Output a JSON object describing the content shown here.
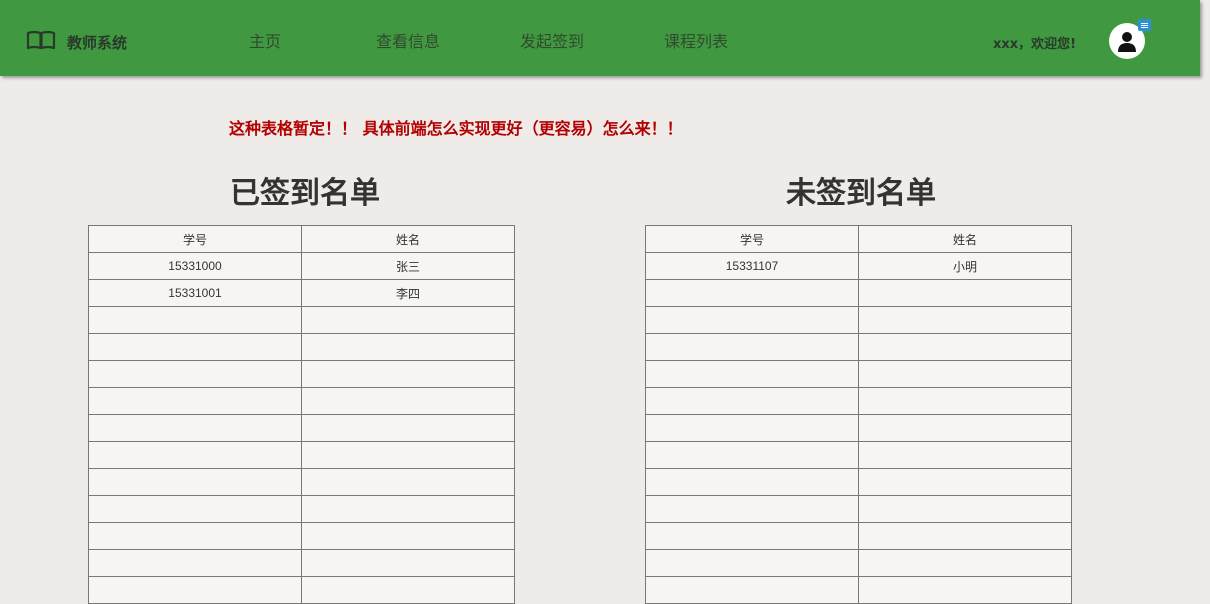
{
  "header": {
    "brand_icon": "open-book-icon",
    "brand_title": "教师系统",
    "nav": [
      {
        "label": "主页"
      },
      {
        "label": "查看信息"
      },
      {
        "label": "发起签到"
      },
      {
        "label": "课程列表"
      }
    ],
    "welcome": "xxx，欢迎您!",
    "avatar_icon": "user-avatar-icon",
    "badge_icon": "menu-badge-icon",
    "accent_color": "#409940"
  },
  "notice": "这种表格暂定！！ 具体前端怎么实现更好（更容易）怎么来！！",
  "signed": {
    "title": "已签到名单",
    "columns": [
      "学号",
      "姓名"
    ],
    "rows": [
      [
        "15331000",
        "张三"
      ],
      [
        "15331001",
        "李四"
      ],
      [
        "",
        ""
      ],
      [
        "",
        ""
      ],
      [
        "",
        ""
      ],
      [
        "",
        ""
      ],
      [
        "",
        ""
      ],
      [
        "",
        ""
      ],
      [
        "",
        ""
      ],
      [
        "",
        ""
      ],
      [
        "",
        ""
      ],
      [
        "",
        ""
      ],
      [
        "",
        ""
      ]
    ]
  },
  "unsigned": {
    "title": "未签到名单",
    "columns": [
      "学号",
      "姓名"
    ],
    "rows": [
      [
        "15331107",
        "小明"
      ],
      [
        "",
        ""
      ],
      [
        "",
        ""
      ],
      [
        "",
        ""
      ],
      [
        "",
        ""
      ],
      [
        "",
        ""
      ],
      [
        "",
        ""
      ],
      [
        "",
        ""
      ],
      [
        "",
        ""
      ],
      [
        "",
        ""
      ],
      [
        "",
        ""
      ],
      [
        "",
        ""
      ],
      [
        "",
        ""
      ]
    ]
  }
}
